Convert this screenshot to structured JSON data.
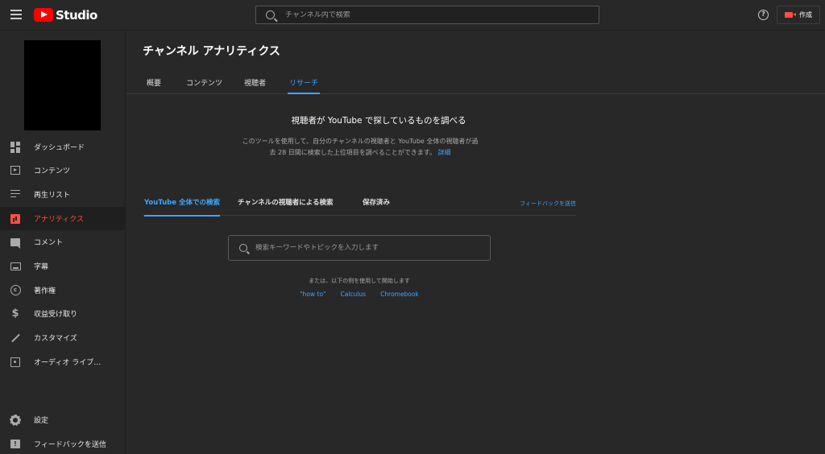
{
  "header": {
    "logo_text": "Studio",
    "search_placeholder": "チャンネル内で検索",
    "help_glyph": "?",
    "create_label": "作成"
  },
  "sidebar": {
    "items": [
      {
        "label": "ダッシュボード",
        "icon": "dashboard-icon"
      },
      {
        "label": "コンテンツ",
        "icon": "content-icon"
      },
      {
        "label": "再生リスト",
        "icon": "playlist-icon"
      },
      {
        "label": "アナリティクス",
        "icon": "analytics-icon",
        "active": true
      },
      {
        "label": "コメント",
        "icon": "comment-icon"
      },
      {
        "label": "字幕",
        "icon": "subtitles-icon"
      },
      {
        "label": "著作権",
        "icon": "copyright-icon"
      },
      {
        "label": "収益受け取り",
        "icon": "dollar-icon"
      },
      {
        "label": "カスタマイズ",
        "icon": "magic-wand-icon"
      },
      {
        "label": "オーディオ ライブ…",
        "icon": "audio-library-icon"
      }
    ],
    "settings_label": "設定",
    "feedback_label": "フィードバックを送信"
  },
  "main": {
    "title": "チャンネル アナリティクス",
    "tabs": [
      {
        "label": "概要"
      },
      {
        "label": "コンテンツ"
      },
      {
        "label": "視聴者"
      },
      {
        "label": "リサーチ",
        "active": true
      }
    ],
    "research": {
      "heading": "視聴者が YouTube で探しているものを調べる",
      "description": "このツールを使用して、自分のチャンネルの視聴者と YouTube 全体の視聴者が過去 28 日間に検索した上位項目を調べることができます。",
      "more_link": "詳細",
      "subtabs": [
        {
          "label": "YouTube 全体での検索",
          "active": true
        },
        {
          "label": "チャンネルの視聴者による検索"
        },
        {
          "label": "保存済み"
        }
      ],
      "feedback_link": "フィードバックを送信",
      "search_placeholder": "検索キーワードやトピックを入力します",
      "examples_label": "または、以下の例を使用して開始します",
      "examples": [
        "\"how to\"",
        "Calculus",
        "Chromebook"
      ]
    }
  },
  "colors": {
    "accent_blue": "#3ea6ff",
    "accent_red": "#ff4e45",
    "background": "#282828"
  }
}
